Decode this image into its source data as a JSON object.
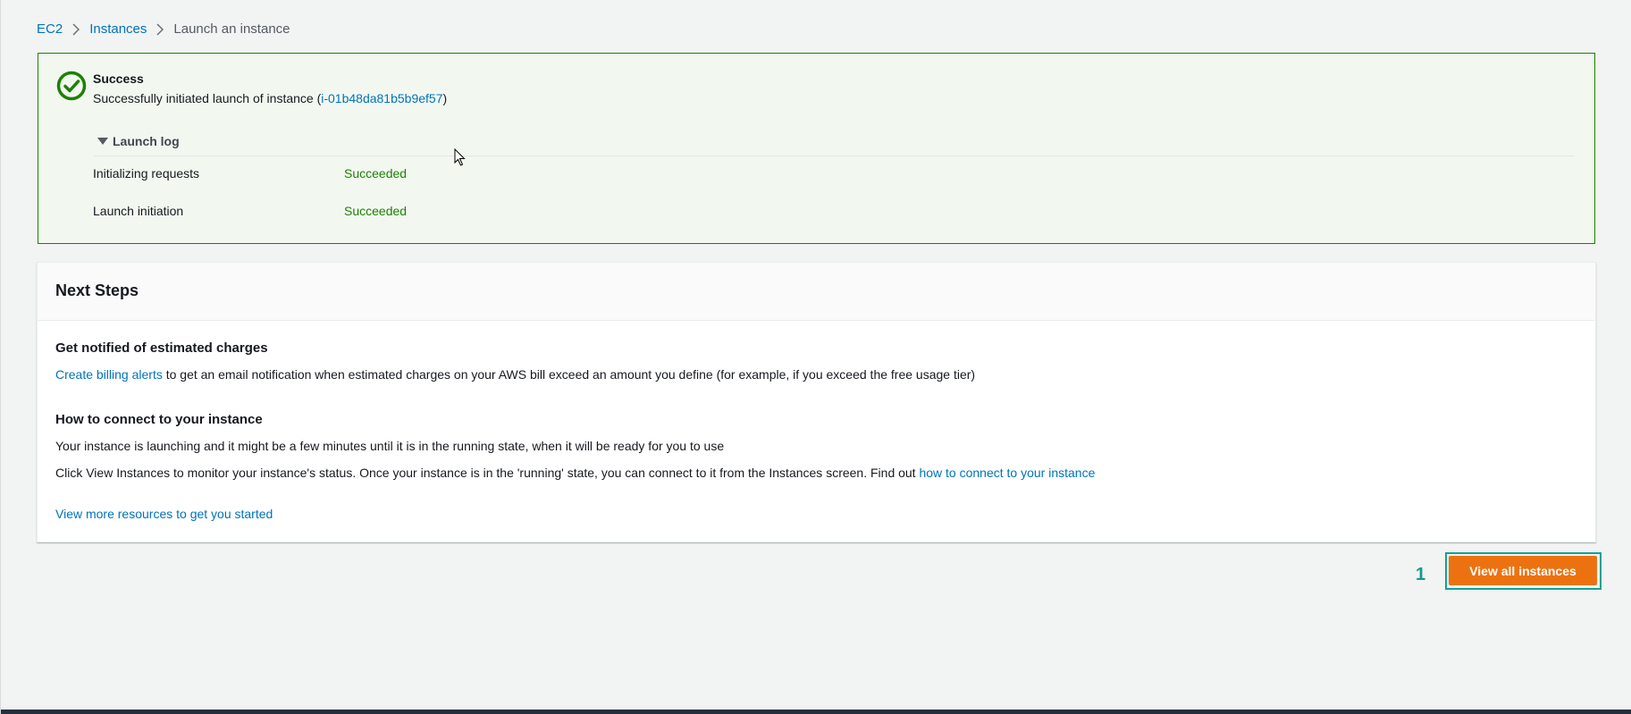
{
  "breadcrumb": {
    "items": [
      "EC2",
      "Instances"
    ],
    "current": "Launch an instance"
  },
  "flash": {
    "type": "success",
    "title": "Success",
    "message_prefix": "Successfully initiated launch of instance (",
    "instance_id": "i-01b48da81b5b9ef57",
    "message_suffix": ")",
    "launch_log": {
      "label": "Launch log",
      "expanded": true,
      "rows": [
        {
          "step": "Initializing requests",
          "status": "Succeeded"
        },
        {
          "step": "Launch initiation",
          "status": "Succeeded"
        }
      ]
    }
  },
  "next_steps": {
    "title": "Next Steps",
    "sections": [
      {
        "heading": "Get notified of estimated charges",
        "link": "Create billing alerts",
        "text": " to get an email notification when estimated charges on your AWS bill exceed an amount you define (for example, if you exceed the free usage tier)"
      },
      {
        "heading": "How to connect to your instance",
        "line1": "Your instance is launching and it might be a few minutes until it is in the running state, when it will be ready for you to use",
        "line2_text": "Click View Instances to monitor your instance's status. Once your instance is in the 'running' state, you can connect to it from the Instances screen. Find out ",
        "line2_link": "how to connect to your instance"
      }
    ],
    "more_resources_link": "View more resources to get you started"
  },
  "footer": {
    "step_number": "1",
    "view_all_button": "View all instances"
  },
  "colors": {
    "link": "#0073bb",
    "success": "#1d8102",
    "primary_button": "#ec7211",
    "highlight": "#10a394"
  },
  "icons": {
    "success": "check-circle-icon",
    "breadcrumb_separator": "chevron-right-icon",
    "expand": "caret-down-icon",
    "cursor": "mouse-pointer-icon"
  }
}
